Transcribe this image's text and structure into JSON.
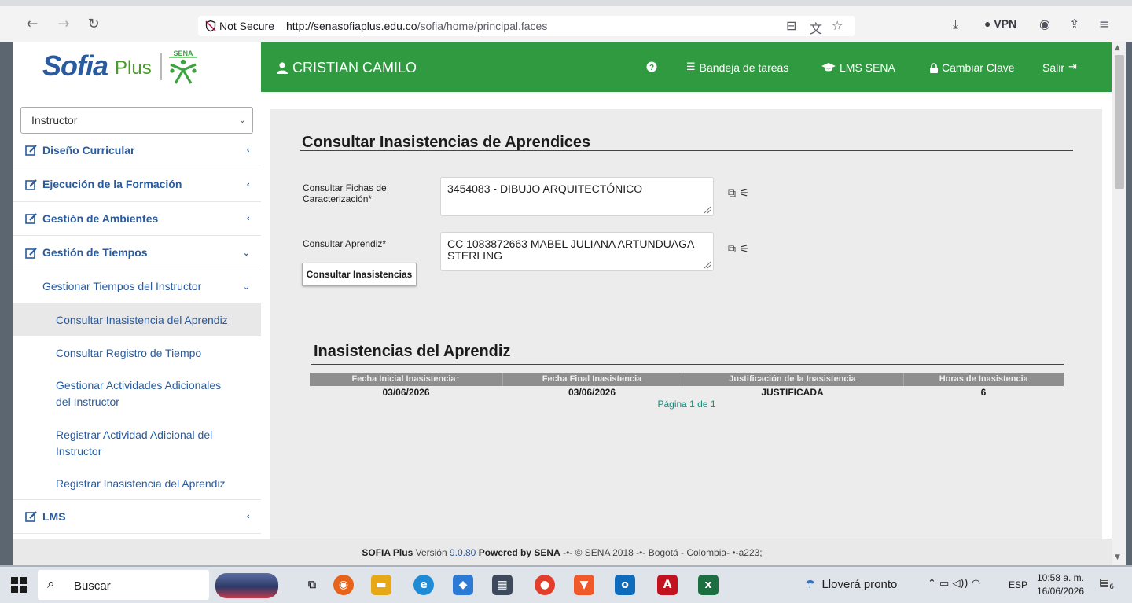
{
  "browser": {
    "security_label": "Not Secure",
    "url_host": "http://senasofiaplus.edu.co",
    "url_path": "/sofia/home/principal.faces",
    "vpn_label": "VPN"
  },
  "logo": {
    "brand": "Sofia",
    "plus": "Plus",
    "sena": "SENA"
  },
  "header": {
    "user_name": "CRISTIAN CAMILO",
    "help_icon": "question-circle-icon",
    "links": [
      {
        "label": "Bandeja de tareas",
        "icon": "inbox-icon"
      },
      {
        "label": "LMS SENA",
        "icon": "graduation-cap-icon"
      },
      {
        "label": "Cambiar Clave",
        "icon": "lock-icon"
      },
      {
        "label": "Salir",
        "icon": "sign-out-icon"
      }
    ]
  },
  "sidebar": {
    "role_selected": "Instructor",
    "items": [
      {
        "label": "Diseño Curricular"
      },
      {
        "label": "Ejecución de la Formación"
      },
      {
        "label": "Gestión de Ambientes"
      },
      {
        "label": "Gestión de Tiempos"
      },
      {
        "label": "Gestionar Tiempos del Instructor"
      },
      {
        "label": "Consultar Inasistencia del Aprendiz"
      },
      {
        "label": "Consultar Registro de Tiempo"
      },
      {
        "label": "Gestionar Actividades Adicionales del Instructor"
      },
      {
        "label": "Registrar Actividad Adicional del Instructor"
      },
      {
        "label": "Registrar Inasistencia del Aprendiz"
      },
      {
        "label": "LMS"
      }
    ]
  },
  "form": {
    "title": "Consultar Inasistencias de Aprendices",
    "ficha_label": "Consultar Fichas de Caracterización*",
    "ficha_value": "3454083 - DIBUJO ARQUITECTÓNICO",
    "aprendiz_label": "Consultar Aprendiz*",
    "aprendiz_value": "CC 1083872663 MABEL JULIANA ARTUNDUAGA STERLING",
    "button_label": "Consultar Inasistencias"
  },
  "results": {
    "title": "Inasistencias del Aprendiz",
    "columns": [
      "Fecha Inicial Inasistencia↑",
      "Fecha Final Inasistencia",
      "Justificación de la Inasistencia",
      "Horas de Inasistencia"
    ],
    "rows": [
      [
        "03/06/2026",
        "03/06/2026",
        "JUSTIFICADA",
        "6"
      ]
    ],
    "pager": "Página 1 de 1"
  },
  "footer": {
    "app": "SOFIA Plus",
    "version_prefix": "Versión",
    "version": "9.0.80",
    "powered": "Powered by SENA",
    "rest": "-•- © SENA 2018 -•- Bogotá - Colombia- •-a223;"
  },
  "taskbar": {
    "search_placeholder": "Buscar",
    "weather": "Lloverá pronto",
    "language": "ESP",
    "time": "10:58 a. m.",
    "date": "16/06/2026",
    "notifications": "6"
  }
}
